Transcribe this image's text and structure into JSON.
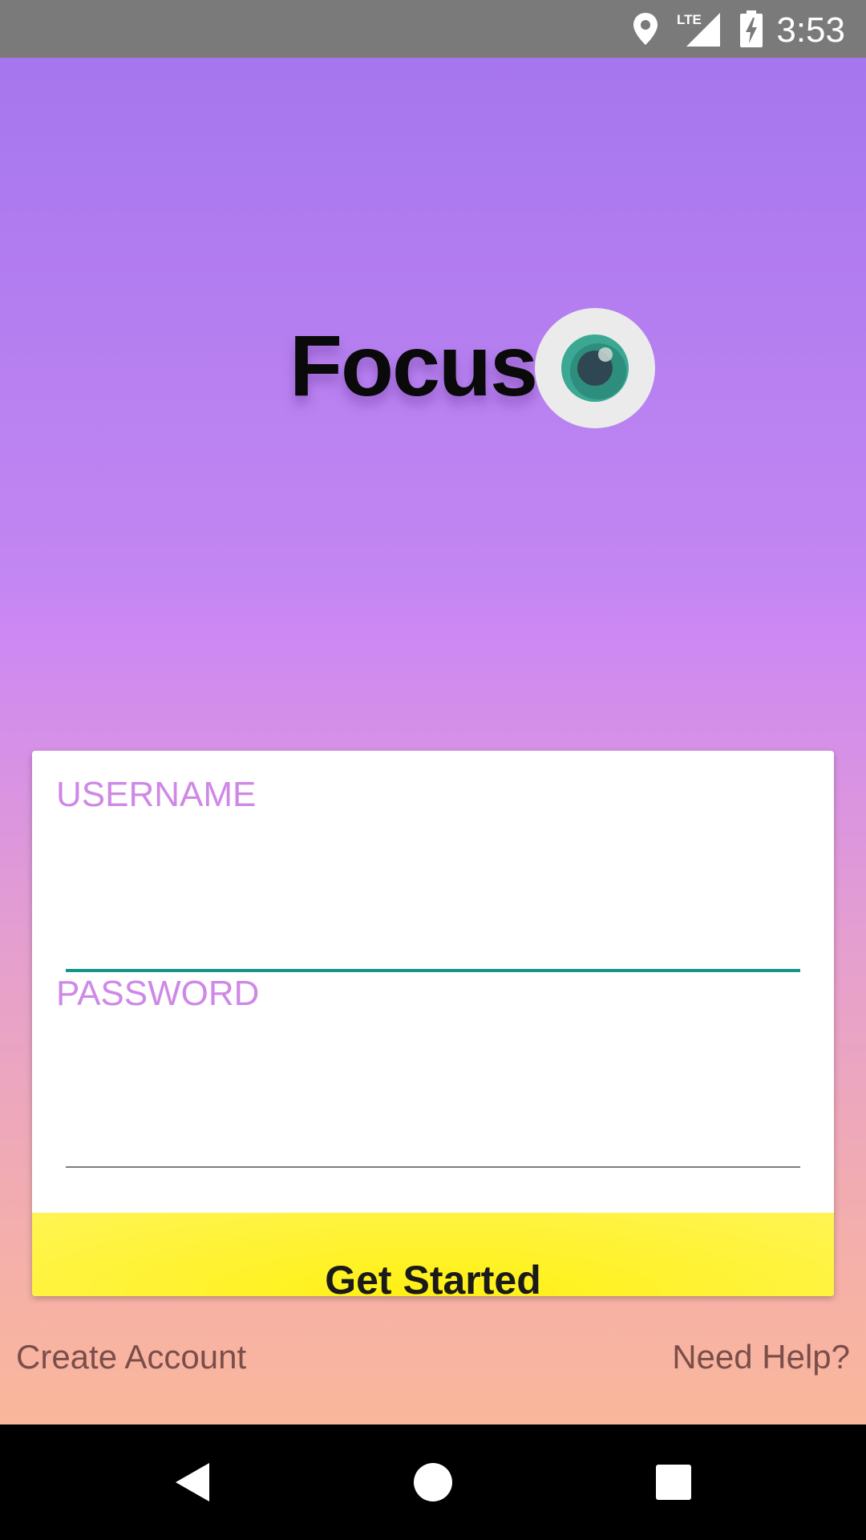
{
  "status_bar": {
    "time": "3:53",
    "icons": [
      "location-icon",
      "lte-signal-icon",
      "battery-charging-icon"
    ],
    "network_label": "LTE"
  },
  "app": {
    "logo_text": "Focus",
    "logo_icon": "eye-icon",
    "colors": {
      "gradient_top": "#a676ee",
      "gradient_bottom": "#fab79b",
      "label_color": "#cf88e6",
      "focus_line": "#16958a",
      "button_yellow": "#fff013"
    }
  },
  "form": {
    "username_label": "USERNAME",
    "username_value": "",
    "password_label": "PASSWORD",
    "password_value": "",
    "submit_label": "Get Started"
  },
  "links": {
    "create_account": "Create Account",
    "need_help": "Need Help?"
  },
  "nav": {
    "icons": [
      "back-icon",
      "home-icon",
      "recents-icon"
    ]
  }
}
